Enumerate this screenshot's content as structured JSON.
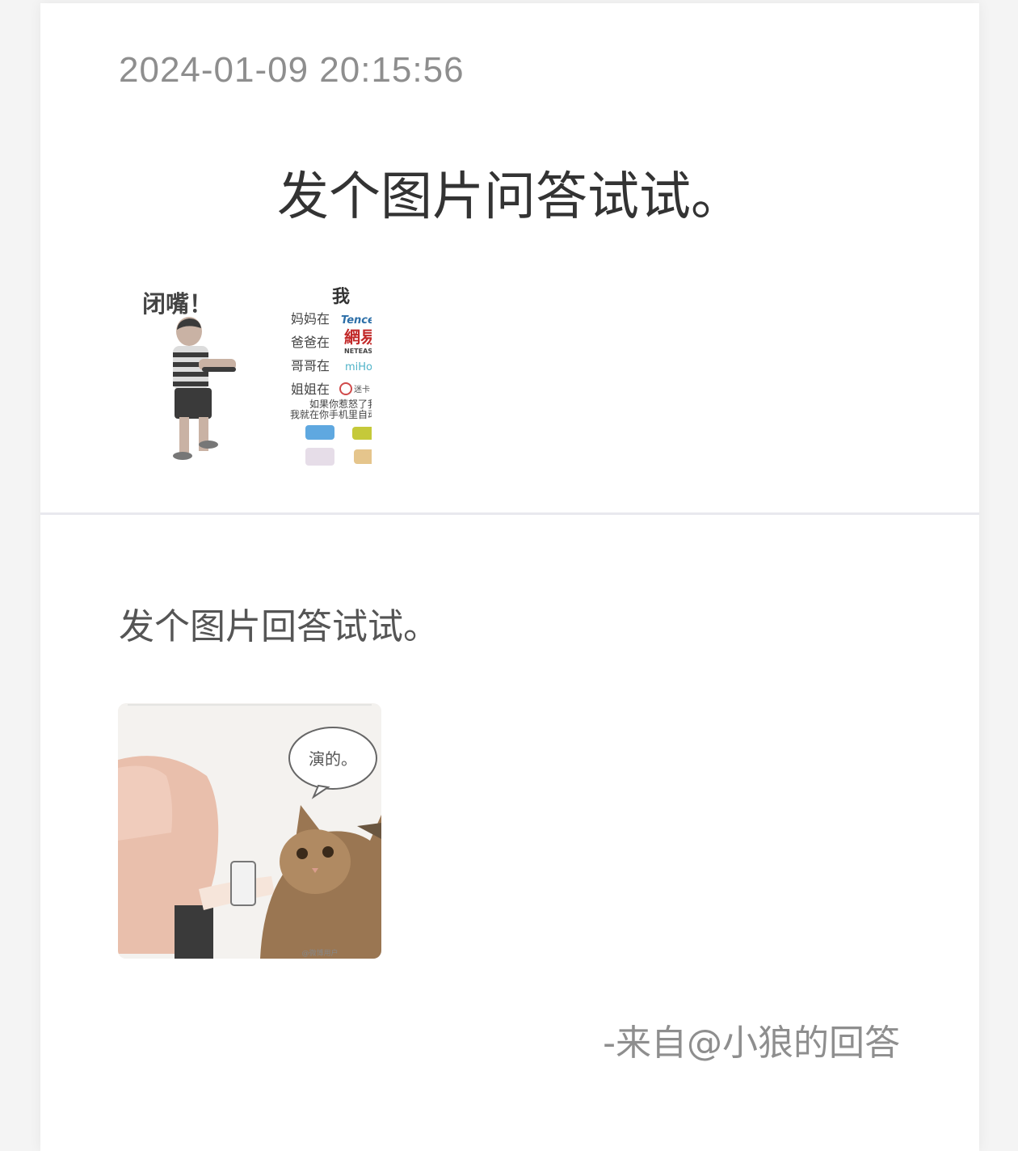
{
  "post": {
    "timestamp": "2024-01-09 20:15:56",
    "question": "发个图片问答试试。"
  },
  "question_image": {
    "left_caption": "闭嘴！",
    "right_title": "我",
    "rows": [
      {
        "label": "妈妈在",
        "brand": "Tencent腾讯"
      },
      {
        "label": "爸爸在",
        "brand": "網易"
      },
      {
        "label": "哥哥在",
        "brand": "miHoYo"
      },
      {
        "label": "姐姐在",
        "brand": "迷卡"
      }
    ],
    "brand_sub_netease": "NETEASE",
    "warning_line1": "如果你惹怒了我",
    "warning_line2": "我就在你手机里自动下载"
  },
  "answer": {
    "text": "发个图片回答试试。",
    "bubble_text": "演的。",
    "source": "-来自@小狼的回答"
  }
}
